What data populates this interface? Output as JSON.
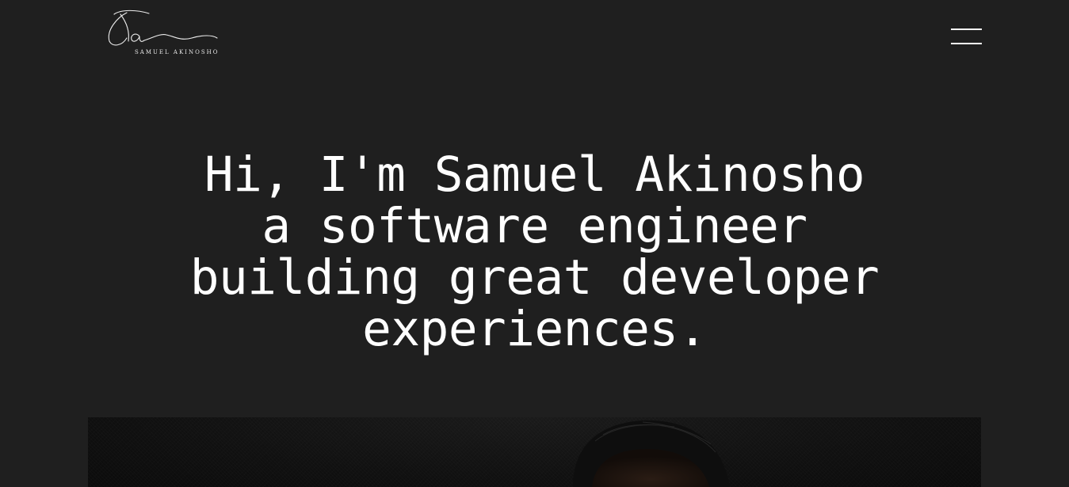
{
  "header": {
    "logo": {
      "monogram": "Sa",
      "name": "SAMUEL AKINOSHO"
    },
    "menu_icon": "hamburger-menu-icon"
  },
  "hero": {
    "line1": "Hi, I'm Samuel Akinosho",
    "line2": "a software engineer",
    "line3": "building great developer",
    "line4": "experiences."
  },
  "photo": {
    "subject": "portrait"
  },
  "colors": {
    "background": "#1f1f1f",
    "text": "#ffffff"
  }
}
